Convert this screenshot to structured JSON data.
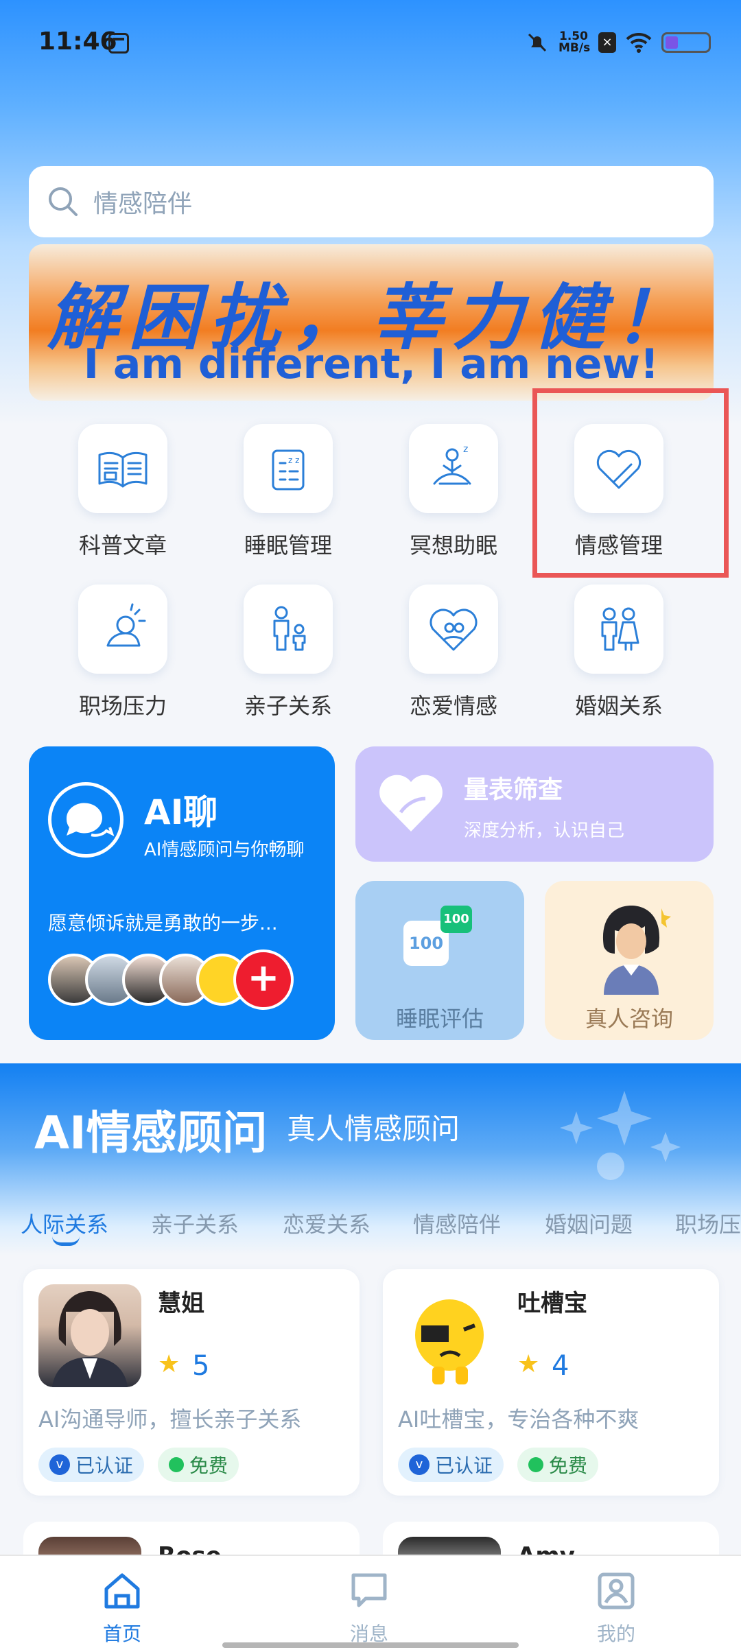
{
  "status_bar": {
    "time": "11:46",
    "speed_value": "1.50",
    "speed_unit": "MB/s"
  },
  "search": {
    "placeholder": "情感陪伴"
  },
  "banner": {
    "title": "解困扰，莘力健！",
    "subtitle": "I am different, I am new!"
  },
  "categories": [
    {
      "label": "科普文章",
      "icon": "book-icon"
    },
    {
      "label": "睡眠管理",
      "icon": "sleep-record-icon"
    },
    {
      "label": "冥想助眠",
      "icon": "meditation-icon"
    },
    {
      "label": "情感管理",
      "icon": "heart-icon"
    },
    {
      "label": "职场压力",
      "icon": "stress-icon"
    },
    {
      "label": "亲子关系",
      "icon": "parent-child-icon"
    },
    {
      "label": "恋爱情感",
      "icon": "love-heart-icon"
    },
    {
      "label": "婚姻关系",
      "icon": "couple-icon"
    }
  ],
  "ai_chat": {
    "title": "AI聊",
    "subtitle": "AI情感顾问与你畅聊",
    "description": "愿意倾诉就是勇敢的一步..."
  },
  "scale": {
    "title": "量表筛查",
    "subtitle": "深度分析，认识自己"
  },
  "sleep_eval": {
    "label": "睡眠评估",
    "badge": "100"
  },
  "human_consult": {
    "label": "真人咨询"
  },
  "consultants": {
    "title": "AI情感顾问",
    "alt_title": "真人情感顾问",
    "tabs": [
      "人际关系",
      "亲子关系",
      "恋爱关系",
      "情感陪伴",
      "婚姻问题",
      "职场压"
    ],
    "active_tab": 0,
    "advisors": [
      {
        "name": "慧姐",
        "rating": "5",
        "description": "AI沟通导师，擅长亲子关系",
        "verified": "已认证",
        "free": "免费"
      },
      {
        "name": "吐槽宝",
        "rating": "4",
        "description": "AI吐槽宝，专治各种不爽",
        "verified": "已认证",
        "free": "免费"
      },
      {
        "name": "Rose"
      },
      {
        "name": "Amy"
      }
    ]
  },
  "nav": {
    "home": "首页",
    "messages": "消息",
    "mine": "我的"
  },
  "colors": {
    "accent": "#1f7ae0",
    "highlight_box": "#ea5656"
  }
}
